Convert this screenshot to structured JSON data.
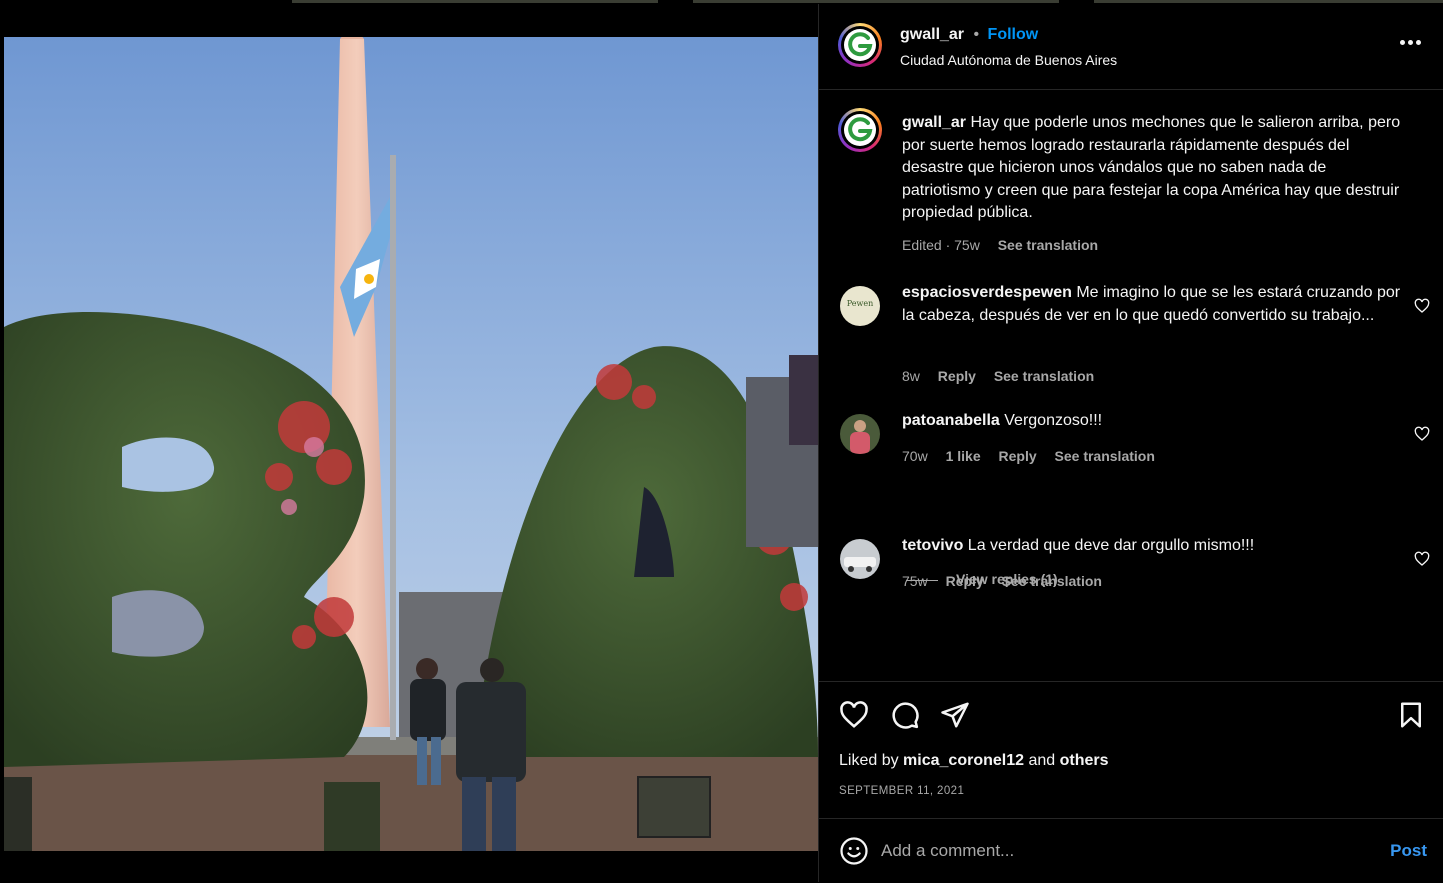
{
  "post": {
    "username": "gwall_ar",
    "separator": "•",
    "follow_label": "Follow",
    "location": "Ciudad Autónoma de Buenos Aires",
    "caption": "Hay que poderle unos mechones que le salieron arriba, pero por suerte hemos logrado restaurarla rápidamente después del desastre que hicieron unos vándalos que no saben nada de patriotismo y creen que para festejar la copa América hay que destruir propiedad pública.",
    "caption_edited": "Edited · 75w",
    "see_translation": "See translation"
  },
  "comments": [
    {
      "username": "espaciosverdespewen",
      "text": "Me imagino lo que se les estará cruzando por la cabeza, después de ver en lo que quedó convertido su trabajo...",
      "age": "8w",
      "likes": "",
      "reply": "Reply",
      "translate": "See translation",
      "avatar_text": "Pewen"
    },
    {
      "username": "patoanabella",
      "text": "Vergonzoso!!!",
      "age": "70w",
      "likes": "1 like",
      "reply": "Reply",
      "translate": "See translation"
    },
    {
      "username": "tetovivo",
      "text": "La verdad que deve dar orgullo mismo!!!",
      "age": "75w",
      "likes": "",
      "reply": "Reply",
      "translate": "See translation"
    }
  ],
  "view_replies": "View replies (1)",
  "likes": {
    "prefix": "Liked by",
    "user": "mica_coronel12",
    "and": "and",
    "others": "others"
  },
  "date": "SEPTEMBER 11, 2021",
  "add_comment": {
    "placeholder": "Add a comment...",
    "post_label": "Post"
  },
  "colors": {
    "accent": "#0095f6",
    "background": "#000000",
    "muted": "#a8a8a8"
  },
  "icons": [
    "more-options-icon",
    "heart-icon",
    "comment-icon",
    "share-icon",
    "bookmark-icon",
    "emoji-icon"
  ]
}
